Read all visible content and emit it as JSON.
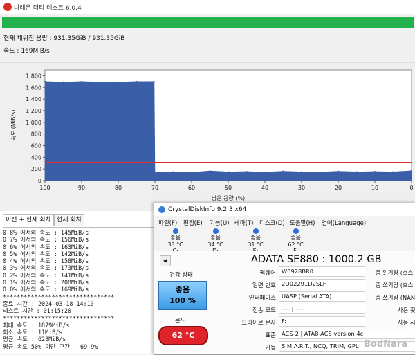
{
  "window": {
    "title": "나래온 더티 테스트 6.0.4"
  },
  "progress": {
    "percent": 100,
    "color": "#22b14c"
  },
  "status": {
    "capacity": "현재 채워진 용량 : 931.35GiB / 931.35GiB",
    "speed": "속도 : 169MiB/s"
  },
  "chart_data": {
    "type": "area",
    "xlabel": "남은 용량 (%)",
    "ylabel": "속도 (MiB/s)",
    "xlim": [
      100,
      0
    ],
    "ylim": [
      0,
      1900
    ],
    "x_ticks": [
      "100",
      "90",
      "80",
      "70",
      "60",
      "50",
      "40",
      "30",
      "20",
      "10",
      "0"
    ],
    "y_ticks": [
      "0",
      "200",
      "400",
      "600",
      "800",
      "1,000",
      "1,200",
      "1,400",
      "1,600",
      "1,800"
    ],
    "series": [
      {
        "x": [
          100,
          95,
          90,
          85,
          80,
          75,
          70.2,
          70,
          65,
          60,
          55,
          50,
          45,
          40,
          35,
          30,
          25,
          20,
          15,
          10,
          5,
          0
        ],
        "values": [
          1700,
          1690,
          1700,
          1690,
          1690,
          1700,
          1700,
          145,
          150,
          140,
          165,
          150,
          155,
          145,
          160,
          150,
          145,
          160,
          150,
          155,
          150,
          169
        ]
      }
    ],
    "reference_line": 315,
    "series_color": "#3a5fa8",
    "reference_color": "#e03030"
  },
  "log": {
    "tabs": [
      "이전 + 현재 회차",
      "현재 회차"
    ],
    "lines": [
      "0.8% 에서의 속도 : 145MiB/s",
      "0.7% 에서의 속도 : 156MiB/s",
      "0.6% 에서의 속도 : 163MiB/s",
      "0.5% 에서의 속도 : 142MiB/s",
      "0.4% 에서의 속도 : 158MiB/s",
      "0.3% 에서의 속도 : 173MiB/s",
      "0.2% 에서의 속도 : 141MiB/s",
      "0.1% 에서의 속도 : 208MiB/s",
      "0.0% 에서의 속도 : 169MiB/s",
      "********************************",
      "종료 시간 : 2024-03-18 14:10",
      "테스트 시간 : 01:15:20",
      "********************************",
      "최대 속도 : 1879MiB/s",
      "최소 속도 : 11MiB/s",
      "평균 속도 : 628MiB/s",
      "평균 속도 50% 미만 구간 : 69.9%"
    ]
  },
  "cdi": {
    "title": "CrystalDiskInfo 9.2.3 x64",
    "menu": [
      "파일(F)",
      "편집(E)",
      "기능(U)",
      "테마(T)",
      "디스크(D)",
      "도움말(H)",
      "언어(Language)"
    ],
    "disks": [
      {
        "status": "좋음",
        "temp": "33 °C",
        "letter": "C:"
      },
      {
        "status": "좋음",
        "temp": "34 °C",
        "letter": "D:"
      },
      {
        "status": "좋음",
        "temp": "31 °C",
        "letter": "E:"
      },
      {
        "status": "좋음",
        "temp": "62 °C",
        "letter": "F:"
      }
    ],
    "disk_name": "ADATA SE880 : 1000.2 GB",
    "health_label": "건강 상태",
    "health_status": "좋음",
    "health_percent": "100 %",
    "temp_label": "온도",
    "temp_value": "62 °C",
    "fields": [
      {
        "label": "펌웨어",
        "value": "W0928BR0"
      },
      {
        "label": "일련 번호",
        "value": "2O02291D2SLF"
      },
      {
        "label": "인터페이스",
        "value": "UASP (Serial ATA)"
      },
      {
        "label": "전송 모드",
        "value": "---- | ----"
      },
      {
        "label": "드라이브 문자",
        "value": "F:"
      },
      {
        "label": "표준",
        "value": "ACS-2 | ATA8-ACS version 4c"
      },
      {
        "label": "기능",
        "value": "S.M.A.R.T., NCQ, TRIM, GPL"
      }
    ],
    "right_labels": [
      "총 읽기량 (호스",
      "총 쓰기량 (호스",
      "총 쓰기량 (NAN",
      "사용 횟",
      "사용 시"
    ]
  },
  "watermark": "BodNara"
}
